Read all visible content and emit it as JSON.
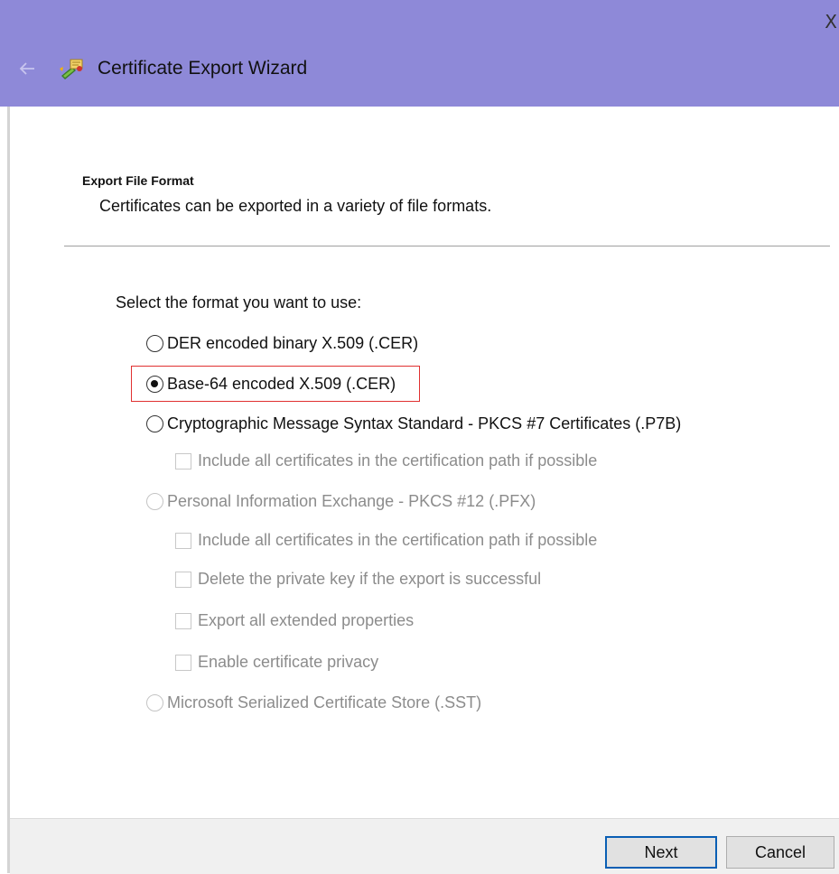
{
  "window": {
    "title": "Certificate Export Wizard",
    "close_glyph": "X",
    "accent_color": "#8e89d8",
    "back_icon": "back-arrow-icon",
    "app_icon": "certificate-wizard-icon"
  },
  "page": {
    "heading": "Export File Format",
    "subheading": "Certificates can be exported in a variety of file formats.",
    "prompt": "Select the format you want to use:"
  },
  "options": {
    "der": {
      "label": "DER encoded binary X.509 (.CER)",
      "checked": false,
      "enabled": true
    },
    "base64": {
      "label": "Base-64 encoded X.509 (.CER)",
      "checked": true,
      "enabled": true,
      "highlight_color": "#e03030"
    },
    "pkcs7": {
      "label": "Cryptographic Message Syntax Standard - PKCS #7 Certificates (.P7B)",
      "checked": false,
      "enabled": true
    },
    "pkcs7_include": {
      "label": "Include all certificates in the certification path if possible",
      "checked": false,
      "enabled": false
    },
    "pfx": {
      "label": "Personal Information Exchange - PKCS #12 (.PFX)",
      "checked": false,
      "enabled": false
    },
    "pfx_include": {
      "label": "Include all certificates in the certification path if possible",
      "checked": false,
      "enabled": false
    },
    "pfx_delete_key": {
      "label": "Delete the private key if the export is successful",
      "checked": false,
      "enabled": false
    },
    "pfx_export_ext": {
      "label": "Export all extended properties",
      "checked": false,
      "enabled": false
    },
    "pfx_privacy": {
      "label": "Enable certificate privacy",
      "checked": false,
      "enabled": false
    },
    "sst": {
      "label": "Microsoft Serialized Certificate Store (.SST)",
      "checked": false,
      "enabled": false
    }
  },
  "footer": {
    "next_label": "Next",
    "cancel_label": "Cancel"
  }
}
